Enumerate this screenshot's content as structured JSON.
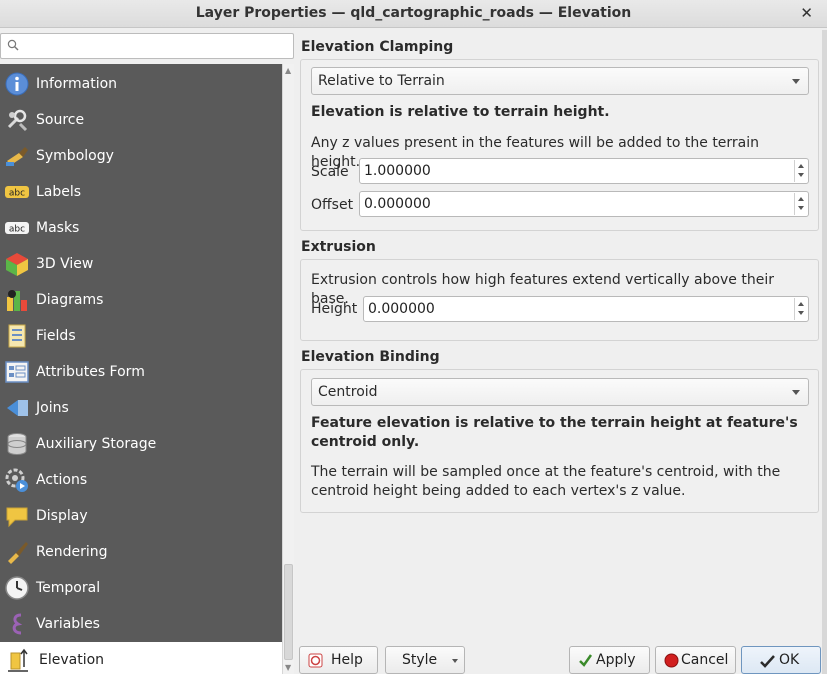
{
  "window": {
    "title": "Layer Properties — qld_cartographic_roads — Elevation",
    "close_glyph": "✕"
  },
  "search": {
    "placeholder": "",
    "value": ""
  },
  "sidebar": {
    "items": [
      {
        "label": "Information",
        "icon": "information-icon"
      },
      {
        "label": "Source",
        "icon": "source-icon"
      },
      {
        "label": "Symbology",
        "icon": "symbology-icon"
      },
      {
        "label": "Labels",
        "icon": "labels-icon"
      },
      {
        "label": "Masks",
        "icon": "masks-icon"
      },
      {
        "label": "3D View",
        "icon": "3d-view-icon"
      },
      {
        "label": "Diagrams",
        "icon": "diagrams-icon"
      },
      {
        "label": "Fields",
        "icon": "fields-icon"
      },
      {
        "label": "Attributes Form",
        "icon": "attributes-form-icon"
      },
      {
        "label": "Joins",
        "icon": "joins-icon"
      },
      {
        "label": "Auxiliary Storage",
        "icon": "auxiliary-storage-icon"
      },
      {
        "label": "Actions",
        "icon": "actions-icon"
      },
      {
        "label": "Display",
        "icon": "display-icon"
      },
      {
        "label": "Rendering",
        "icon": "rendering-icon"
      },
      {
        "label": "Temporal",
        "icon": "temporal-icon"
      },
      {
        "label": "Variables",
        "icon": "variables-icon"
      },
      {
        "label": "Elevation",
        "icon": "elevation-icon",
        "active": true
      }
    ],
    "icon_text": {
      "labels": "abc",
      "masks": "abc"
    }
  },
  "clamping": {
    "title": "Elevation Clamping",
    "mode": "Relative to Terrain",
    "bold_desc": "Elevation is relative to terrain height.",
    "desc": "Any z values present in the features will be added to the terrain height.",
    "scale_label": "Scale",
    "scale_value": "1.000000",
    "offset_label": "Offset",
    "offset_value": "0.000000"
  },
  "extrusion": {
    "title": "Extrusion",
    "desc": "Extrusion controls how high features extend vertically above their base.",
    "height_label": "Height",
    "height_value": "0.000000"
  },
  "binding": {
    "title": "Elevation Binding",
    "mode": "Centroid",
    "bold_desc": "Feature elevation is relative to the terrain height at feature's centroid only.",
    "desc": "The terrain will be sampled once at the feature's centroid, with the centroid height being added to each vertex's z value."
  },
  "buttons": {
    "help": "Help",
    "style": "Style",
    "apply": "Apply",
    "cancel": "Cancel",
    "ok": "OK"
  },
  "colors": {
    "sidebar_bg": "#5a5a5a",
    "sidebar_active_bg": "#ffffff",
    "cancel_red": "#d11f1f",
    "apply_green": "#3a8a2a"
  }
}
